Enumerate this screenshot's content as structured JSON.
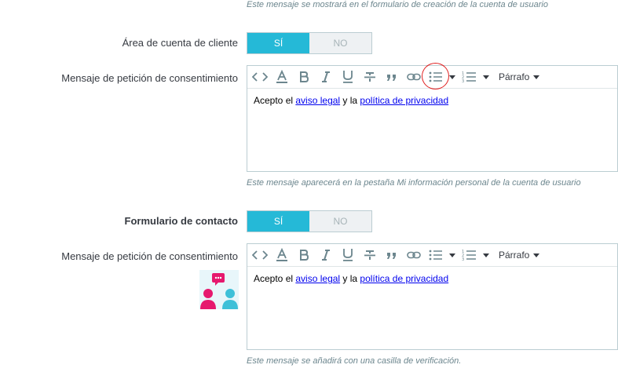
{
  "section1": {
    "top_help": "Este mensaje se mostrará en el formulario de creación de la cuenta de usuario",
    "customer_area_label": "Área de cuenta de cliente",
    "switch_yes": "SÍ",
    "switch_no": "NO",
    "consent_label": "Mensaje de petición de consentimiento",
    "editor_text_before": "Acepto el ",
    "editor_link1": "aviso legal",
    "editor_text_mid": " y la ",
    "editor_link2": "política de privacidad",
    "help": "Este mensaje aparecerá en la pestaña Mi información personal de la cuenta de usuario"
  },
  "section2": {
    "contact_form_label": "Formulario de contacto",
    "switch_yes": "SÍ",
    "switch_no": "NO",
    "consent_label": "Mensaje de petición de consentimiento",
    "editor_text_before": "Acepto el ",
    "editor_link1": "aviso legal",
    "editor_text_mid": " y la ",
    "editor_link2": "política de privacidad",
    "help": "Este mensaje se añadirá con una casilla de verificación."
  },
  "toolbar": {
    "format_label": "Párrafo",
    "icons": [
      "code-icon",
      "text-color-icon",
      "bold-icon",
      "italic-icon",
      "underline-icon",
      "strikethrough-icon",
      "quote-icon",
      "link-icon",
      "bullet-list-icon",
      "numbered-list-icon"
    ]
  },
  "colors": {
    "accent": "#25b9d7",
    "annotation": "#e02020",
    "illustration_pink": "#e6186e",
    "illustration_blue": "#3ec0d8"
  }
}
